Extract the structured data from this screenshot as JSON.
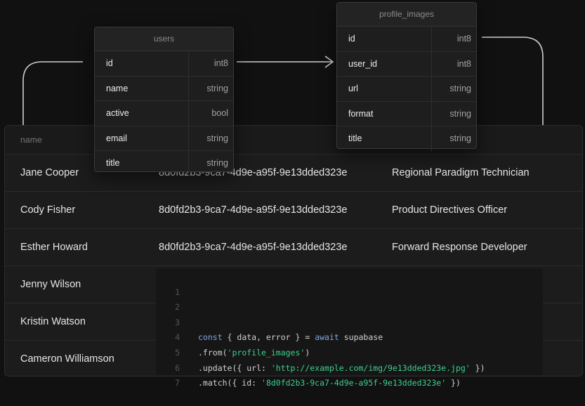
{
  "users_table": {
    "title": "users",
    "fields": [
      {
        "name": "id",
        "type": "int8"
      },
      {
        "name": "name",
        "type": "string"
      },
      {
        "name": "active",
        "type": "bool"
      },
      {
        "name": "email",
        "type": "string"
      },
      {
        "name": "title",
        "type": "string"
      }
    ]
  },
  "profile_images_table": {
    "title": "profile_images",
    "fields": [
      {
        "name": "id",
        "type": "int8"
      },
      {
        "name": "user_id",
        "type": "int8"
      },
      {
        "name": "url",
        "type": "string"
      },
      {
        "name": "format",
        "type": "string"
      },
      {
        "name": "title",
        "type": "string"
      }
    ]
  },
  "data_grid": {
    "header": "name",
    "rows": [
      {
        "name": "Jane Cooper",
        "id": "8d0fd2b3-9ca7-4d9e-a95f-9e13dded323e",
        "title": "Regional Paradigm Technician"
      },
      {
        "name": "Cody Fisher",
        "id": "8d0fd2b3-9ca7-4d9e-a95f-9e13dded323e",
        "title": "Product Directives Officer"
      },
      {
        "name": "Esther Howard",
        "id": "8d0fd2b3-9ca7-4d9e-a95f-9e13dded323e",
        "title": "Forward Response Developer"
      },
      {
        "name": "Jenny Wilson",
        "id": "",
        "title": ""
      },
      {
        "name": "Kristin Watson",
        "id": "",
        "title": ""
      },
      {
        "name": "Cameron Williamson",
        "id": "",
        "title": ""
      }
    ]
  },
  "code": {
    "line_numbers": [
      "1",
      "2",
      "3",
      "4",
      "5",
      "6",
      "7"
    ],
    "line3": {
      "kw1": "const",
      "mid": " { data, error } = ",
      "kw2": "await",
      "end": " supabase"
    },
    "line4": {
      "pre": ".from(",
      "str": "'profile_images'",
      "post": ")"
    },
    "line5": {
      "pre": ".update({ url: ",
      "str": "'http://example.com/img/9e13dded323e.jpg'",
      "post": " })"
    },
    "line6": {
      "pre": ".match({ id: ",
      "str": "'8d0fd2b3-9ca7-4d9e-a95f-9e13dded323e'",
      "post": " })"
    }
  },
  "colors": {
    "background": "#111111",
    "card": "#1e1e1e",
    "keyword": "#7fa6e3",
    "string": "#3ecf8e"
  }
}
